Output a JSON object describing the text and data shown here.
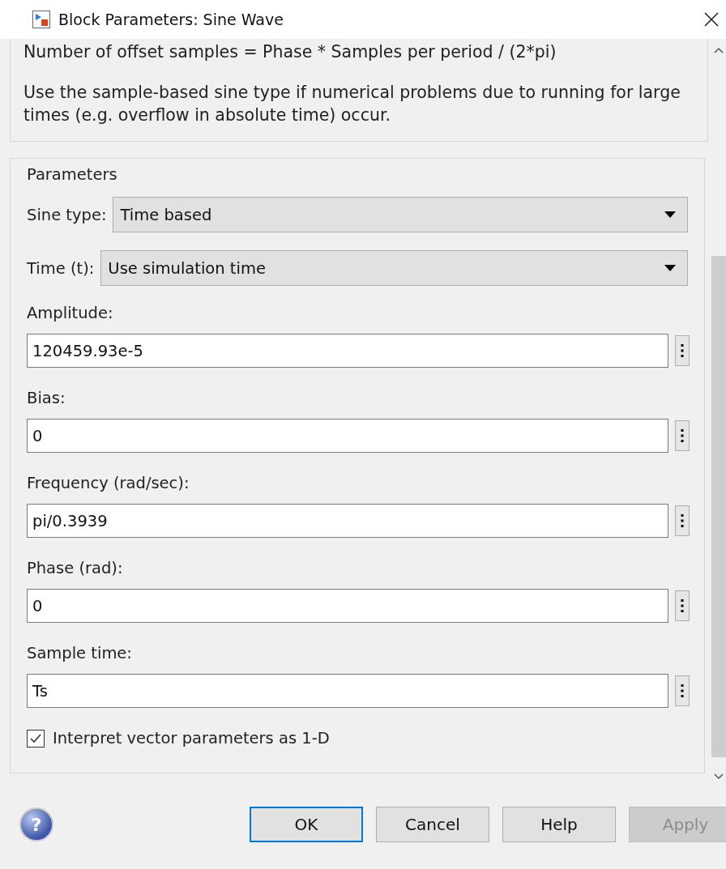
{
  "window": {
    "title": "Block Parameters: Sine Wave"
  },
  "description": [
    "Number of offset samples = Phase * Samples per period / (2*pi)",
    "Use the sample-based sine type if numerical problems due to running for large times (e.g. overflow in absolute time) occur."
  ],
  "parameters": {
    "title": "Parameters",
    "items": [
      {
        "kind": "dropdown",
        "label": "Sine type:",
        "value": "Time based"
      },
      {
        "kind": "dropdown",
        "label": "Time (t):",
        "value": "Use simulation time"
      },
      {
        "kind": "edit",
        "label": "Amplitude:",
        "value": "120459.93e-5"
      },
      {
        "kind": "edit",
        "label": "Bias:",
        "value": "0"
      },
      {
        "kind": "edit",
        "label": "Frequency (rad/sec):",
        "value": "pi/0.3939"
      },
      {
        "kind": "edit",
        "label": "Phase (rad):",
        "value": "0"
      },
      {
        "kind": "edit",
        "label": "Sample time:",
        "value": "Ts"
      },
      {
        "kind": "checkbox",
        "label": "Interpret vector parameters as 1-D",
        "checked": true
      }
    ]
  },
  "help_icon": "?",
  "buttons": [
    {
      "label": "OK",
      "focused": true,
      "disabled": false
    },
    {
      "label": "Cancel",
      "focused": false,
      "disabled": false
    },
    {
      "label": "Help",
      "focused": false,
      "disabled": false
    },
    {
      "label": "Apply",
      "focused": false,
      "disabled": true
    }
  ]
}
